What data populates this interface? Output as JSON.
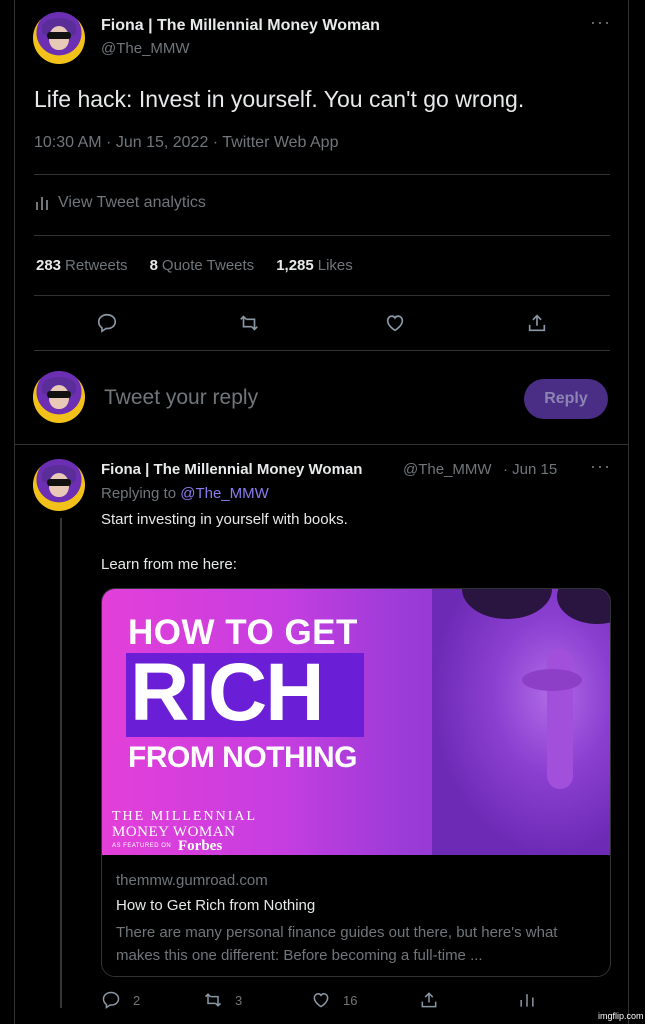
{
  "main_tweet": {
    "author_name": "Fiona | The Millennial Money Woman",
    "author_handle": "@The_MMW",
    "text": "Life hack: Invest in yourself. You can't go wrong.",
    "meta": "10:30 AM · Jun 15, 2022 · Twitter Web App",
    "analytics_label": "View Tweet analytics",
    "stats": {
      "retweets_count": "283",
      "retweets_label": "Retweets",
      "quotes_count": "8",
      "quotes_label": "Quote Tweets",
      "likes_count": "1,285",
      "likes_label": "Likes"
    },
    "actions": [
      "reply-icon",
      "retweet-icon",
      "like-icon",
      "share-icon"
    ]
  },
  "composer": {
    "placeholder": "Tweet your reply",
    "button_label": "Reply"
  },
  "reply_tweet": {
    "author_name": "Fiona | The Millennial Money Woman",
    "author_handle": "@The_MMW",
    "date": "· Jun 15",
    "replying_prefix": "Replying to",
    "replying_handle": "@The_MMW",
    "line1": "Start investing in yourself with books.",
    "line2": "Learn from me here:",
    "card": {
      "image_top": "HOW TO GET",
      "image_main": "RICH",
      "image_bottom": "FROM NOTHING",
      "brand_line1": "THE MILLENNIAL",
      "brand_line2": "MONEY WOMAN",
      "brand_line3": "AS FEATURED ON",
      "brand_forbes": "Forbes",
      "domain": "themmw.gumroad.com",
      "title": "How to Get Rich from Nothing",
      "description": "There are many personal finance guides out there, but here's what makes this one different: Before becoming a full-time ..."
    },
    "counts": {
      "replies": "2",
      "retweets": "3",
      "likes": "16"
    }
  },
  "watermark": "imgflip.com"
}
